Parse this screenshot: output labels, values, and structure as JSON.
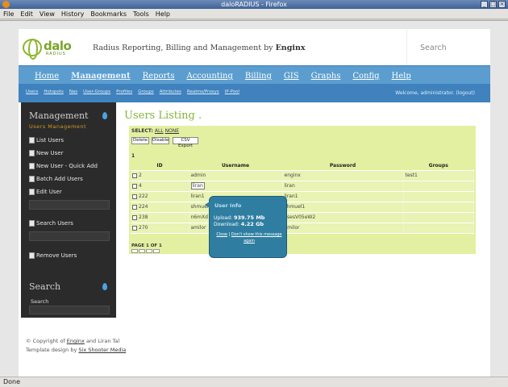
{
  "window": {
    "title": "daloRADIUS - Firefox"
  },
  "menubar": [
    "File",
    "Edit",
    "View",
    "History",
    "Bookmarks",
    "Tools",
    "Help"
  ],
  "status_bar": "Done",
  "header": {
    "logo_text": "dalo",
    "logo_sub": "RADIUS",
    "tagline": "Radius Reporting, Billing and Management by",
    "tagline_brand": "Enginx",
    "search_label": "Search"
  },
  "nav": {
    "main": [
      "Home",
      "Management",
      "Reports",
      "Accounting",
      "Billing",
      "GIS",
      "Graphs",
      "Config",
      "Help"
    ],
    "active": "Management",
    "sub": [
      "Users",
      "Hotspots",
      "Nas",
      "User-Groups",
      "Profiles",
      "Groups",
      "Attributes",
      "Realms/Proxys",
      "IP-Pool"
    ],
    "welcome": "Welcome, administrator. (logout)"
  },
  "sidebar": {
    "title": "Management",
    "subtitle": "Users Management",
    "items": [
      "List Users",
      "New User",
      "New User - Quick Add",
      "Batch Add Users",
      "Edit User",
      "Search Users",
      "Remove Users"
    ],
    "search_title": "Search",
    "search_label": "Search"
  },
  "content": {
    "title": "Users Listing",
    "select_prefix": "SELECT:",
    "select_all": "ALL",
    "select_none": "NONE",
    "buttons": [
      "Delete",
      "Disable",
      "CSV Export"
    ],
    "count": "1",
    "columns": [
      "ID",
      "Username",
      "Password",
      "Groups"
    ],
    "rows": [
      {
        "id": "2",
        "username": "admin",
        "password": "enginx",
        "groups": "test1"
      },
      {
        "id": "4",
        "username": "liran",
        "password": "liran",
        "groups": ""
      },
      {
        "id": "222",
        "username": "liran1",
        "password": "liran1",
        "groups": ""
      },
      {
        "id": "224",
        "username": "shmuel",
        "password": "shmuel1",
        "groups": ""
      },
      {
        "id": "238",
        "username": "n6mXd",
        "password": "ysesV05eW2",
        "groups": ""
      },
      {
        "id": "270",
        "username": "amilor",
        "password": "amilor",
        "groups": ""
      }
    ],
    "pagination": "PAGE 1 OF 1"
  },
  "tooltip": {
    "title": "User Info",
    "upload_label": "Upload:",
    "upload_value": "939.75 Mb",
    "download_label": "Download:",
    "download_value": "4.22 Gb",
    "close": "Close",
    "dont_show": "Don't show this message again"
  },
  "footer": {
    "line1_prefix": "© Copyright of",
    "line1_link": "Enginx",
    "line1_suffix": "and Liran Tal",
    "line2_prefix": "Template design by",
    "line2_link": "Six Shooter Media"
  }
}
